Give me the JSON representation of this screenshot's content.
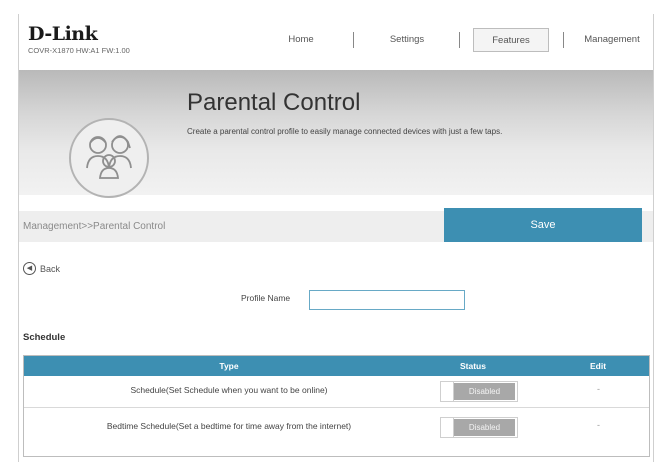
{
  "header": {
    "logo": "D-Link",
    "model": "COVR-X1870 HW:A1 FW:1.00",
    "nav": [
      "Home",
      "Settings",
      "Features",
      "Management"
    ],
    "active_nav": "Features"
  },
  "banner": {
    "title": "Parental Control",
    "description": "Create a parental control profile to easily manage connected devices with just a few taps.",
    "icon": "family-icon"
  },
  "breadcrumb": "Management>>Parental Control",
  "save_label": "Save",
  "back_label": "Back",
  "profile": {
    "label": "Profile Name",
    "value": "",
    "placeholder": ""
  },
  "schedule": {
    "title": "Schedule",
    "columns": [
      "Type",
      "Status",
      "Edit"
    ],
    "rows": [
      {
        "type": "Schedule(Set Schedule when you want to be online)",
        "status": "Disabled",
        "edit": "-"
      },
      {
        "type": "Bedtime Schedule(Set a bedtime for time away from the internet)",
        "status": "Disabled",
        "edit": "-"
      }
    ]
  },
  "colors": {
    "accent": "#3d8fb2",
    "toggle_off": "#a8a8a8"
  }
}
